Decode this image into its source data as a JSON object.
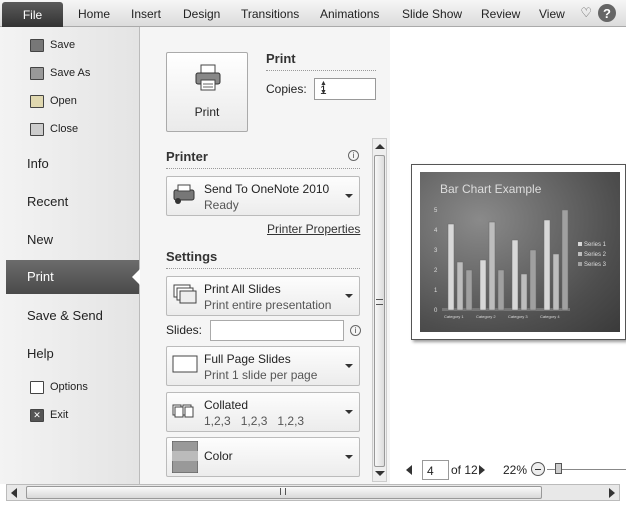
{
  "ribbon": {
    "file": "File",
    "tabs": [
      "Home",
      "Insert",
      "Design",
      "Transitions",
      "Animations",
      "Slide Show",
      "Review",
      "View"
    ],
    "help": "?"
  },
  "backstage": {
    "commands": [
      "Save",
      "Save As",
      "Open",
      "Close"
    ],
    "items": [
      "Info",
      "Recent",
      "New",
      "Print",
      "Save & Send",
      "Help"
    ],
    "bottom": [
      "Options",
      "Exit"
    ]
  },
  "print": {
    "button_label": "Print",
    "header": "Print",
    "copies_label": "Copies:",
    "copies_value": "1"
  },
  "printer": {
    "header": "Printer",
    "name": "Send To OneNote 2010",
    "status": "Ready",
    "properties_link": "Printer Properties"
  },
  "settings": {
    "header": "Settings",
    "range_title": "Print All Slides",
    "range_sub": "Print entire presentation",
    "slides_label": "Slides:",
    "slides_value": "",
    "layout_title": "Full Page Slides",
    "layout_sub": "Print 1 slide per page",
    "collate_title": "Collated",
    "collate_sub": "1,2,3   1,2,3   1,2,3",
    "color_title": "Color"
  },
  "preview": {
    "slide_title": "Bar Chart Example",
    "current_page": "4",
    "of_pages": "of 12",
    "zoom": "22%"
  },
  "chart_data": {
    "type": "bar",
    "title": "Bar Chart Example",
    "categories": [
      "Category 1",
      "Category 2",
      "Category 3",
      "Category 4"
    ],
    "series": [
      {
        "name": "Series 1",
        "values": [
          4.3,
          2.5,
          3.5,
          4.5
        ]
      },
      {
        "name": "Series 2",
        "values": [
          2.4,
          4.4,
          1.8,
          2.8
        ]
      },
      {
        "name": "Series 3",
        "values": [
          2,
          2,
          3,
          5
        ]
      }
    ],
    "ylim": [
      0,
      5
    ],
    "yticks": [
      "0",
      "1",
      "2",
      "3",
      "4",
      "5"
    ],
    "legend": "right"
  }
}
